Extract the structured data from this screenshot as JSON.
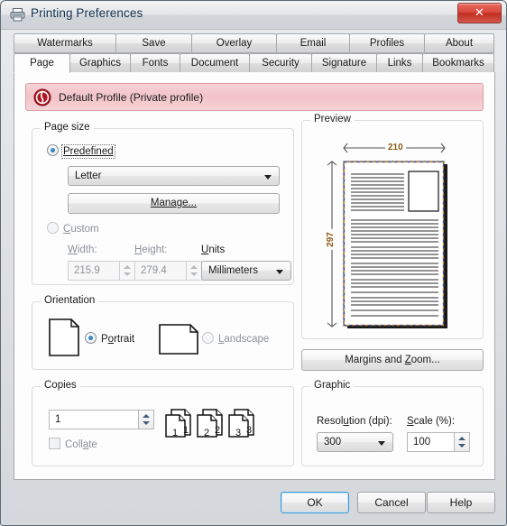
{
  "window": {
    "title": "Printing Preferences",
    "icon": "printer-icon",
    "close_label": "✕"
  },
  "tabs": {
    "row1": [
      {
        "label": "Watermarks",
        "active": false
      },
      {
        "label": "Save",
        "active": false
      },
      {
        "label": "Overlay",
        "active": false
      },
      {
        "label": "Email",
        "active": false
      },
      {
        "label": "Profiles",
        "active": false
      },
      {
        "label": "About",
        "active": false
      }
    ],
    "row2": [
      {
        "label": "Page",
        "active": true
      },
      {
        "label": "Graphics",
        "active": false
      },
      {
        "label": "Fonts",
        "active": false
      },
      {
        "label": "Document",
        "active": false
      },
      {
        "label": "Security",
        "active": false
      },
      {
        "label": "Signature",
        "active": false
      },
      {
        "label": "Links",
        "active": false
      },
      {
        "label": "Bookmarks",
        "active": false
      }
    ]
  },
  "profile": {
    "text": "Default Profile (Private profile)",
    "icon": "profile-badge-icon",
    "background": "#f2c3c8",
    "border": "#d9a0a5"
  },
  "page_size": {
    "group_title": "Page size",
    "predefined_label": "Predefined",
    "predefined_selected": true,
    "predefined_value": "Letter",
    "manage_label": "Manage...",
    "custom_label": "Custom",
    "custom_selected": false,
    "width_label": "Width:",
    "width_value": "215.9",
    "height_label": "Height:",
    "height_value": "279.4",
    "units_label": "Units",
    "units_value": "Millimeters"
  },
  "orientation": {
    "group_title": "Orientation",
    "portrait_label": "Portrait",
    "portrait_selected": true,
    "landscape_label": "Landscape",
    "landscape_selected": false
  },
  "copies": {
    "group_title": "Copies",
    "count_value": "1",
    "collate_label": "Collate",
    "collate_checked": false,
    "stack_numbers": [
      "1",
      "2",
      "3"
    ]
  },
  "preview": {
    "group_title": "Preview",
    "width_dim": "210",
    "height_dim": "297",
    "margin_color": "#3b4fb0",
    "dim_color": "#8a5a10"
  },
  "margins_button": {
    "label": "Margins and Zoom..."
  },
  "graphic": {
    "group_title": "Graphic",
    "resolution_label": "Resolution (dpi):",
    "resolution_value": "300",
    "scale_label": "Scale (%):",
    "scale_value": "100"
  },
  "footer": {
    "ok_label": "OK",
    "cancel_label": "Cancel",
    "help_label": "Help"
  }
}
